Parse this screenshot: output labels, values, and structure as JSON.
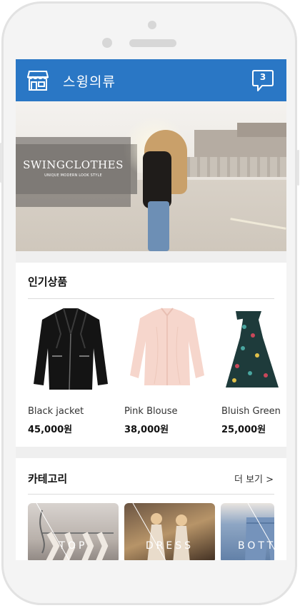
{
  "app": {
    "title": "스윙의류",
    "chat_count": "3"
  },
  "hero": {
    "brand": "SWINGCLOTHES",
    "tagline": "UNIQUE MODERN LOOK STYLE"
  },
  "popular": {
    "title": "인기상품",
    "products": [
      {
        "name": "Black jacket",
        "price": "45,000원"
      },
      {
        "name": "Pink Blouse",
        "price": "38,000원"
      },
      {
        "name": "Bluish Green",
        "price": "25,000원"
      }
    ]
  },
  "category": {
    "title": "카테고리",
    "more": "더 보기 >",
    "items": [
      {
        "label": "TOP"
      },
      {
        "label": "DRESS"
      },
      {
        "label": "BOTTOM"
      }
    ]
  },
  "colors": {
    "brand": "#2a77c5"
  }
}
